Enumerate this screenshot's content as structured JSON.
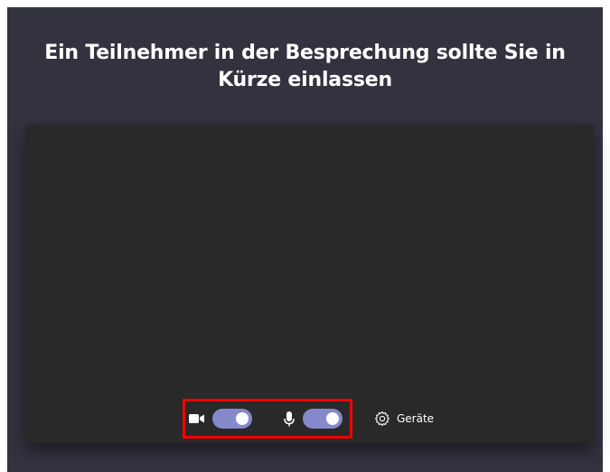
{
  "lobby": {
    "title": "Ein Teilnehmer in der Besprechung sollte Sie in Kürze einlassen"
  },
  "controls": {
    "camera": {
      "icon": "camera-icon",
      "on": true
    },
    "microphone": {
      "icon": "microphone-icon",
      "on": true
    },
    "devices": {
      "icon": "gear-icon",
      "label": "Geräte"
    }
  },
  "colors": {
    "background": "#33323f",
    "video_preview": "#292929",
    "toggle_on": "#8589cc",
    "highlight": "#ff0000"
  }
}
